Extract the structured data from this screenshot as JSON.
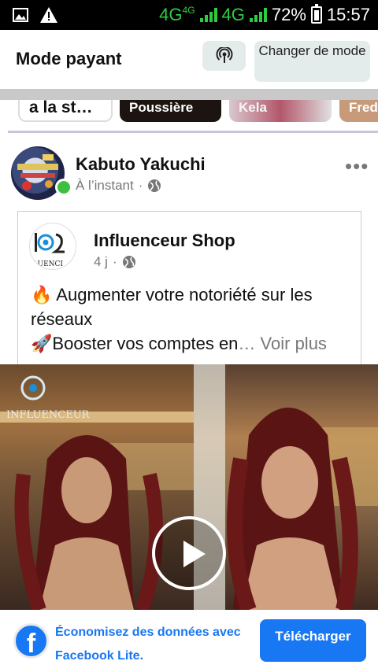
{
  "status_bar": {
    "network_primary": "4G",
    "network_secondary": "4G",
    "battery": "72%",
    "time": "15:57",
    "icons": [
      "image-icon",
      "warning-icon",
      "signal-icon",
      "battery-icon"
    ]
  },
  "header": {
    "title": "Mode payant",
    "cast_icon": "broadcast-icon",
    "mode_button": "Changer de mode"
  },
  "stories": [
    {
      "label": "a la st…"
    },
    {
      "label": "Poussière"
    },
    {
      "label": "Kela"
    },
    {
      "label": "Fred"
    }
  ],
  "post": {
    "author": "Kabuto Yakuchi",
    "time": "À l’instant",
    "separator": "·",
    "more": "•••",
    "shared": {
      "page_name": "Influenceur Shop",
      "time": "4 j",
      "separator": "·",
      "line1_emoji": "🔥",
      "line1": " Augmenter votre notoriété sur les réseaux",
      "line2_emoji": "🚀",
      "line2": "Booster vos comptes en",
      "ellipsis": "… ",
      "see_more": "Voir plus"
    },
    "video_watermark": "INFLUENCEUR",
    "logo_text": "LUENCI"
  },
  "promo_bar": {
    "text": "Économisez des données avec Facebook Lite.",
    "button": "Télécharger",
    "logo": "f"
  },
  "colors": {
    "fb_blue": "#1877f2",
    "online_green": "#3fbf3f",
    "signal_green": "#2ecc40",
    "button_gray": "#e4eceb"
  }
}
